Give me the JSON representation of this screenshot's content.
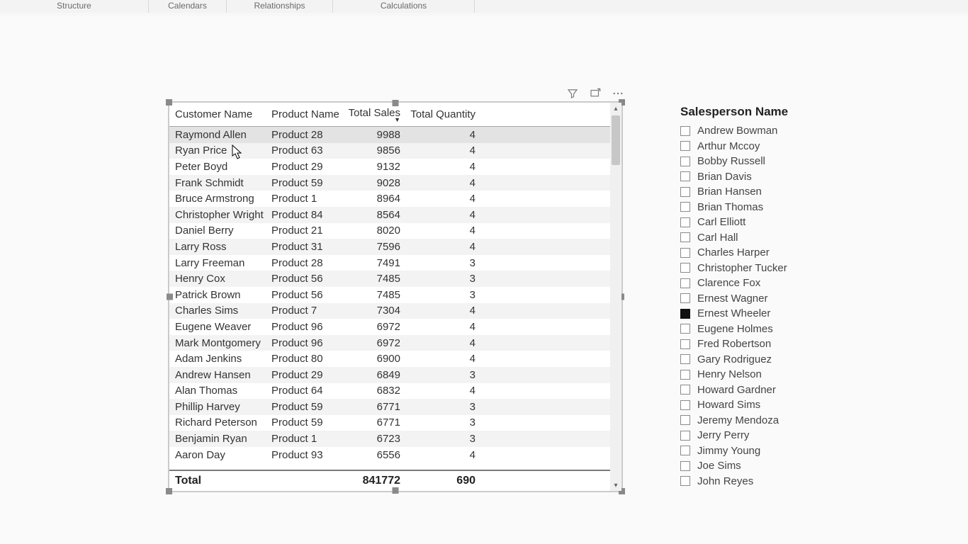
{
  "ribbon": {
    "groups": [
      "Structure",
      "Calendars",
      "Relationships",
      "Calculations"
    ]
  },
  "visual_icons": {
    "filter": "filter-icon",
    "focus": "focus-mode-icon",
    "more": "more-options-icon"
  },
  "table": {
    "columns": [
      "Customer Name",
      "Product Name",
      "Total Sales",
      "Total Quantity"
    ],
    "sort_column": "Total Sales",
    "sort_direction": "desc",
    "rows": [
      {
        "customer": "Raymond Allen",
        "product": "Product 28",
        "sales": "9988",
        "qty": "4",
        "hover": true
      },
      {
        "customer": "Ryan Price",
        "product": "Product 63",
        "sales": "9856",
        "qty": "4"
      },
      {
        "customer": "Peter Boyd",
        "product": "Product 29",
        "sales": "9132",
        "qty": "4"
      },
      {
        "customer": "Frank Schmidt",
        "product": "Product 59",
        "sales": "9028",
        "qty": "4"
      },
      {
        "customer": "Bruce Armstrong",
        "product": "Product 1",
        "sales": "8964",
        "qty": "4"
      },
      {
        "customer": "Christopher Wright",
        "product": "Product 84",
        "sales": "8564",
        "qty": "4"
      },
      {
        "customer": "Daniel Berry",
        "product": "Product 21",
        "sales": "8020",
        "qty": "4"
      },
      {
        "customer": "Larry Ross",
        "product": "Product 31",
        "sales": "7596",
        "qty": "4"
      },
      {
        "customer": "Larry Freeman",
        "product": "Product 28",
        "sales": "7491",
        "qty": "3"
      },
      {
        "customer": "Henry Cox",
        "product": "Product 56",
        "sales": "7485",
        "qty": "3"
      },
      {
        "customer": "Patrick Brown",
        "product": "Product 56",
        "sales": "7485",
        "qty": "3"
      },
      {
        "customer": "Charles Sims",
        "product": "Product 7",
        "sales": "7304",
        "qty": "4"
      },
      {
        "customer": "Eugene Weaver",
        "product": "Product 96",
        "sales": "6972",
        "qty": "4"
      },
      {
        "customer": "Mark Montgomery",
        "product": "Product 96",
        "sales": "6972",
        "qty": "4"
      },
      {
        "customer": "Adam Jenkins",
        "product": "Product 80",
        "sales": "6900",
        "qty": "4"
      },
      {
        "customer": "Andrew Hansen",
        "product": "Product 29",
        "sales": "6849",
        "qty": "3"
      },
      {
        "customer": "Alan Thomas",
        "product": "Product 64",
        "sales": "6832",
        "qty": "4"
      },
      {
        "customer": "Phillip Harvey",
        "product": "Product 59",
        "sales": "6771",
        "qty": "3"
      },
      {
        "customer": "Richard Peterson",
        "product": "Product 59",
        "sales": "6771",
        "qty": "3"
      },
      {
        "customer": "Benjamin Ryan",
        "product": "Product 1",
        "sales": "6723",
        "qty": "3"
      },
      {
        "customer": "Aaron Day",
        "product": "Product 93",
        "sales": "6556",
        "qty": "4"
      }
    ],
    "total_label": "Total",
    "total_sales": "841772",
    "total_qty": "690"
  },
  "slicer": {
    "title": "Salesperson Name",
    "items": [
      {
        "name": "Andrew Bowman",
        "checked": false
      },
      {
        "name": "Arthur Mccoy",
        "checked": false
      },
      {
        "name": "Bobby Russell",
        "checked": false
      },
      {
        "name": "Brian Davis",
        "checked": false
      },
      {
        "name": "Brian Hansen",
        "checked": false
      },
      {
        "name": "Brian Thomas",
        "checked": false
      },
      {
        "name": "Carl Elliott",
        "checked": false
      },
      {
        "name": "Carl Hall",
        "checked": false
      },
      {
        "name": "Charles Harper",
        "checked": false
      },
      {
        "name": "Christopher Tucker",
        "checked": false
      },
      {
        "name": "Clarence Fox",
        "checked": false
      },
      {
        "name": "Ernest Wagner",
        "checked": false
      },
      {
        "name": "Ernest Wheeler",
        "checked": true
      },
      {
        "name": "Eugene Holmes",
        "checked": false
      },
      {
        "name": "Fred Robertson",
        "checked": false
      },
      {
        "name": "Gary Rodriguez",
        "checked": false
      },
      {
        "name": "Henry Nelson",
        "checked": false
      },
      {
        "name": "Howard Gardner",
        "checked": false
      },
      {
        "name": "Howard Sims",
        "checked": false
      },
      {
        "name": "Jeremy Mendoza",
        "checked": false
      },
      {
        "name": "Jerry Perry",
        "checked": false
      },
      {
        "name": "Jimmy Young",
        "checked": false
      },
      {
        "name": "Joe Sims",
        "checked": false
      },
      {
        "name": "John Reyes",
        "checked": false
      }
    ]
  }
}
